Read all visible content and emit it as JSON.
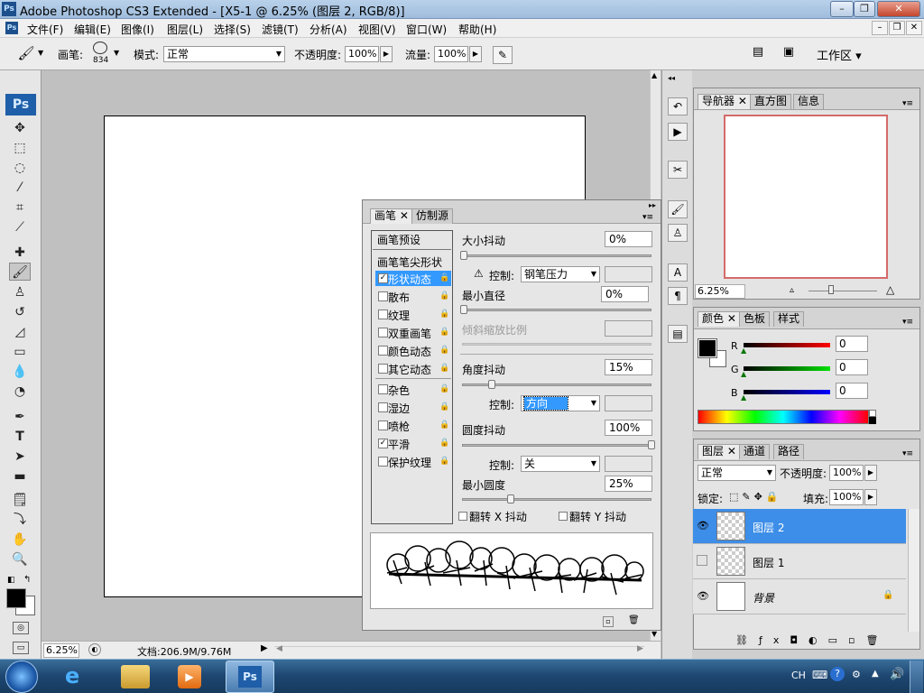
{
  "window": {
    "app_icon": "Ps",
    "title": "Adobe Photoshop CS3 Extended - [X5-1 @ 6.25% (图层 2, RGB/8)]",
    "buttons": {
      "minimize": "–",
      "restore": "❐",
      "close": "✕"
    }
  },
  "menu": {
    "items": [
      "文件(F)",
      "编辑(E)",
      "图像(I)",
      "图层(L)",
      "选择(S)",
      "滤镜(T)",
      "分析(A)",
      "视图(V)",
      "窗口(W)",
      "帮助(H)"
    ]
  },
  "options": {
    "brush_label": "画笔:",
    "brush_size": "834",
    "mode_label": "模式:",
    "mode_value": "正常",
    "opacity_label": "不透明度:",
    "opacity_value": "100%",
    "flow_label": "流量:",
    "flow_value": "100%",
    "workspace_label": "工作区"
  },
  "toolbox": {
    "ps_label": "Ps"
  },
  "status": {
    "zoom": "6.25%",
    "doc_info": "文档:206.9M/9.76M"
  },
  "brush_panel": {
    "tabs": [
      "画笔",
      "仿制源"
    ],
    "presets_label": "画笔预设",
    "tip_shape_label": "画笔笔尖形状",
    "options": [
      {
        "label": "形状动态",
        "checked": true,
        "selected": true
      },
      {
        "label": "散布",
        "checked": false
      },
      {
        "label": "纹理",
        "checked": false
      },
      {
        "label": "双重画笔",
        "checked": false
      },
      {
        "label": "颜色动态",
        "checked": false
      },
      {
        "label": "其它动态",
        "checked": false
      },
      {
        "label": "杂色",
        "checked": false
      },
      {
        "label": "湿边",
        "checked": false
      },
      {
        "label": "喷枪",
        "checked": false
      },
      {
        "label": "平滑",
        "checked": true
      },
      {
        "label": "保护纹理",
        "checked": false
      }
    ],
    "size_jitter_label": "大小抖动",
    "size_jitter_value": "0%",
    "control_label": "控制:",
    "control1_value": "钢笔压力",
    "min_diameter_label": "最小直径",
    "min_diameter_value": "0%",
    "tilt_scale_label": "倾斜缩放比例",
    "angle_jitter_label": "角度抖动",
    "angle_jitter_value": "15%",
    "control2_value": "方向",
    "roundness_jitter_label": "圆度抖动",
    "roundness_jitter_value": "100%",
    "control3_value": "关",
    "min_roundness_label": "最小圆度",
    "min_roundness_value": "25%",
    "flip_x_label": "翻转 X 抖动",
    "flip_y_label": "翻转 Y 抖动",
    "levels": {
      "size_jitter": 0,
      "min_diameter": 0,
      "angle_jitter": 0.15,
      "roundness_jitter": 1.0,
      "min_roundness": 0.25
    }
  },
  "navigator": {
    "tabs": [
      "导航器",
      "直方图",
      "信息"
    ],
    "zoom": "6.25%"
  },
  "color_panel": {
    "tabs": [
      "颜色",
      "色板",
      "样式"
    ],
    "channels": [
      {
        "name": "R",
        "value": "0",
        "color": "#e02020"
      },
      {
        "name": "G",
        "value": "0",
        "color": "#20c020"
      },
      {
        "name": "B",
        "value": "0",
        "color": "#2020e0"
      }
    ]
  },
  "layers_panel": {
    "tabs": [
      "图层",
      "通道",
      "路径"
    ],
    "blend_mode": "正常",
    "opacity_label": "不透明度:",
    "opacity_value": "100%",
    "lock_label": "锁定:",
    "fill_label": "填充:",
    "fill_value": "100%",
    "layers": [
      {
        "name": "图层 2",
        "visible": true,
        "selected": true
      },
      {
        "name": "图层 1",
        "visible": false,
        "selected": false
      },
      {
        "name": "背景",
        "visible": true,
        "selected": false,
        "locked": true
      }
    ]
  },
  "taskbar": {
    "lang": "CH",
    "ps_label": "Ps"
  },
  "colors": {
    "selection": "#3399ff",
    "layer_selected": "#3d8ee8",
    "taskbar": "#1d4670"
  }
}
